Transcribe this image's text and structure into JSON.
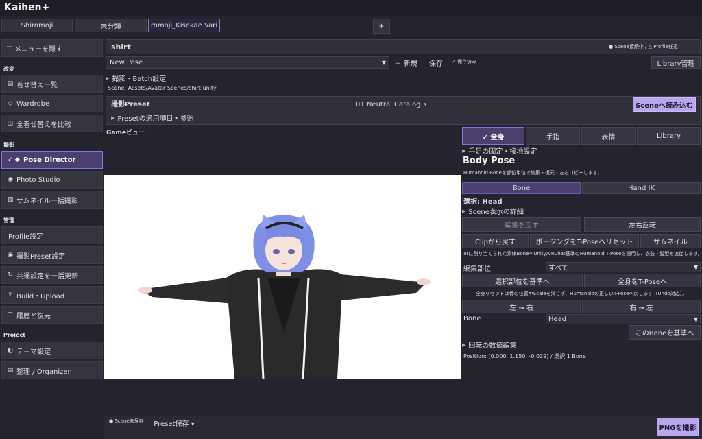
{
  "app": {
    "title": "Kaihen+"
  },
  "tabs": [
    {
      "label": "Shiromoji"
    },
    {
      "label": "未分類"
    },
    {
      "label": "romoji_Kisekae Vari"
    }
  ],
  "add_tab_label": "+",
  "sidebar": {
    "toggle_label": "☰ メニューを隠す",
    "sections": {
      "kaihen": "改変",
      "satsuei": "撮影",
      "kanri": "管理",
      "project": "Project"
    },
    "items": [
      {
        "icon": "▤",
        "label": "着せ替え一覧"
      },
      {
        "icon": "◇",
        "label": "Wardrobe"
      },
      {
        "icon": "◫",
        "label": "全着せ替えを比較"
      },
      {
        "icon": "✓ ◆",
        "label": "Pose Director"
      },
      {
        "icon": "◉",
        "label": "Photo Studio"
      },
      {
        "icon": "▧",
        "label": "サムネイル一括撮影"
      },
      {
        "icon": "",
        "label": "Profile設定"
      },
      {
        "icon": "◉",
        "label": "撮影Preset設定"
      },
      {
        "icon": "↻",
        "label": "共通設定を一括更新"
      },
      {
        "icon": "⇧",
        "label": "Build・Upload"
      },
      {
        "icon": "⌒",
        "label": "履歴と復元"
      },
      {
        "icon": "◐",
        "label": "テーマ設定"
      },
      {
        "icon": "▤",
        "label": "整理 / Organizer"
      }
    ]
  },
  "header": {
    "outfit_name": "shirt",
    "scene_status": "● Scene接続中 / △ Profile任意"
  },
  "pose_bar": {
    "pose_select": "New Pose",
    "new_label": "＋ 新規",
    "save_label": "保存",
    "saved_status": "✓ 保存済み",
    "library_label": "Library管理"
  },
  "batch": {
    "foldout": "撮影・Batch設定",
    "scene_path": "Scene: Assets/Avatar Scenes/shirt.unity"
  },
  "preset": {
    "label": "撮影Preset",
    "value": "01 Neutral Catalog",
    "load_button": "Sceneへ読み込む",
    "foldout": "Presetの適用項目・参照"
  },
  "game_view": {
    "label": "Gameビュー"
  },
  "right_panel": {
    "mode_tabs": [
      "✓ 全身",
      "手指",
      "表情",
      "Library"
    ],
    "fix_foldout": "手足の固定・接地設定",
    "title": "Body Pose",
    "description": "Humanoid Boneを部位単位で編集・復元・左右コピーします。",
    "sub_tabs": [
      "Bone",
      "Hand IK"
    ],
    "selection": "選択: Head",
    "scene_detail_foldout": "Scene表示の詳細",
    "undo_edit": "編集を戻す",
    "mirror": "左右反転",
    "from_clip": "Clipから戻す",
    "reset_tpose": "ポージングをT-Poseへリセット",
    "thumbnail": "サムネイル",
    "info_line": ":orに割り当てられた素体BoneへUnity/VRChat基準のHumanoid T-Poseを適用し、衣装・髪型も追従します。",
    "edit_part_label": "編集部位",
    "edit_part_value": "すべて",
    "base_selected": "選択部位を基準へ",
    "full_tpose": "全身をT-Poseへ",
    "reset_note": "全身リセットは骨の位置やScaleを消さず、Humanoidの正しいT-Poseへ戻します（Undo対応）。",
    "left_to_right": "左 → 右",
    "right_to_left": "右 → 左",
    "bone_label": "Bone",
    "bone_value": "Head",
    "bone_base": "このBoneを基準へ",
    "rotation_foldout": "回転の数値編集",
    "position_readout": "Position: (0.000, 1.150, -0.029) / 選択 1 Bone"
  },
  "footer": {
    "scene_unsaved": "● Scene未保存",
    "preset_save": "Preset保存 ▾",
    "png_button": "PNGを撮影"
  },
  "colors": {
    "accent": "#b9a6ec",
    "selected": "#4a3f6e",
    "background": "#24242e"
  }
}
